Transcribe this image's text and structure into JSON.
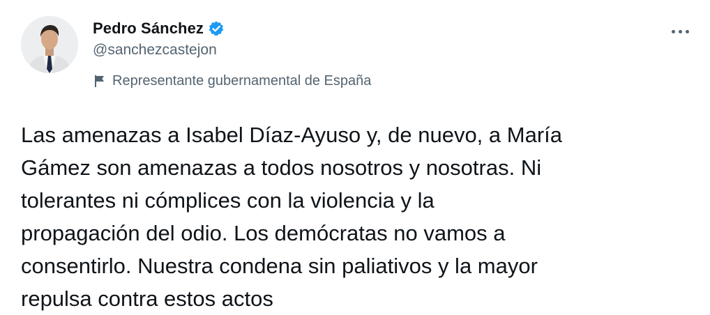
{
  "author": {
    "display_name": "Pedro Sánchez",
    "handle": "@sanchezcastejon",
    "verified": true,
    "verified_color": "#1d9bf0",
    "label_icon": "flag-icon",
    "label": "Representante gubernamental de España"
  },
  "more_icon": "more-dots-icon",
  "tweet": {
    "text": "Las amenazas a Isabel Díaz-Ayuso y, de nuevo, a María\nGámez son amenazas a todos nosotros y nosotras. Ni\ntolerantes ni cómplices con la violencia y la\npropagación del odio. Los demócratas no vamos a\nconsentirlo. Nuestra condena sin paliativos y la mayor\nrepulsa contra estos actos"
  },
  "colors": {
    "text_primary": "#0f1419",
    "text_secondary": "#536471",
    "background": "#ffffff"
  }
}
